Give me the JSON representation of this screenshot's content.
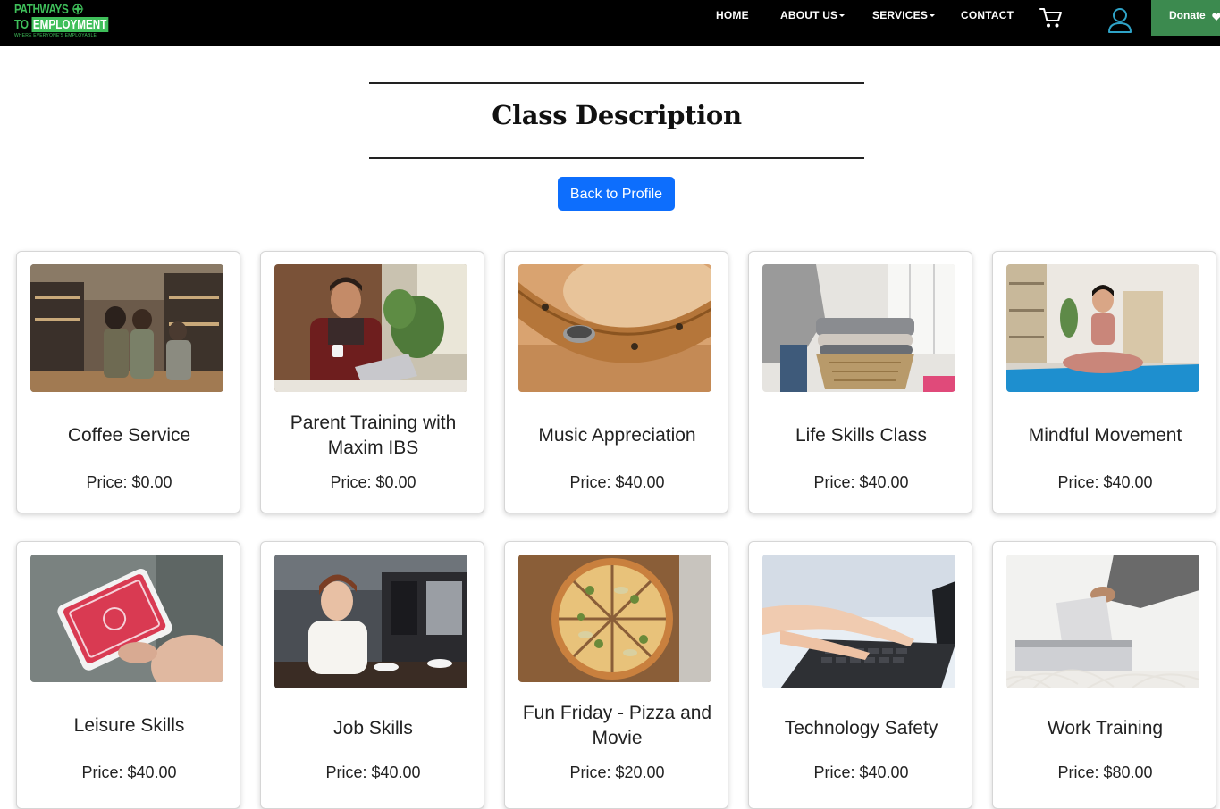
{
  "brand": {
    "line1": "PATHWAYS",
    "line2_to": "TO",
    "line2_emp": "EMPLOYMENT",
    "tagline": "WHERE EVERYONE'S EMPLOYABLE"
  },
  "nav": {
    "home": "HOME",
    "about": "ABOUT US",
    "services": "SERVICES",
    "contact": "CONTACT",
    "donate": "Donate"
  },
  "page": {
    "title": "Class Description",
    "back_button": "Back to Profile"
  },
  "colors": {
    "brand_green": "#3fbf5a",
    "donate_green": "#3c8a4f",
    "primary_blue": "#0d6efd",
    "user_icon": "#2fa3c7"
  },
  "classes": [
    {
      "name": "Coffee Service",
      "price": "Price: $0.00",
      "image": "coffee-shop-photo"
    },
    {
      "name": "Parent Training with Maxim IBS",
      "price": "Price: $0.00",
      "image": "man-laptop-photo"
    },
    {
      "name": "Music Appreciation",
      "price": "Price: $40.00",
      "image": "tambourine-photo"
    },
    {
      "name": "Life Skills Class",
      "price": "Price: $40.00",
      "image": "laundry-basket-photo"
    },
    {
      "name": "Mindful Movement",
      "price": "Price: $40.00",
      "image": "yoga-woman-photo"
    },
    {
      "name": "Leisure Skills",
      "price": "Price: $40.00",
      "image": "playing-cards-photo"
    },
    {
      "name": "Job Skills",
      "price": "Price: $40.00",
      "image": "barista-photo"
    },
    {
      "name": "Fun Friday - Pizza and Movie",
      "price": "Price: $20.00",
      "image": "pizza-photo"
    },
    {
      "name": "Technology Safety",
      "price": "Price: $40.00",
      "image": "typing-laptop-photo"
    },
    {
      "name": "Work Training",
      "price": "Price: $80.00",
      "image": "paper-shredder-photo"
    }
  ]
}
